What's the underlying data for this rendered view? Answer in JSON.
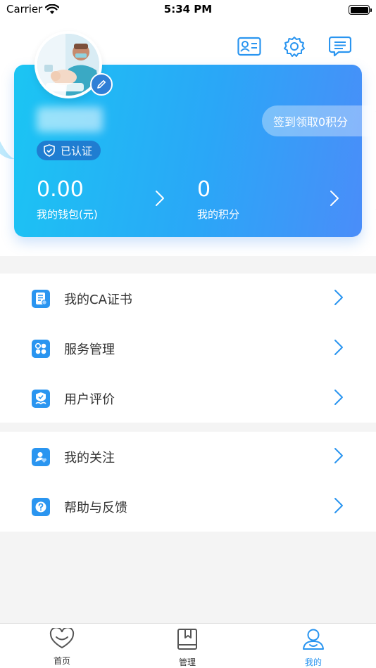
{
  "status_bar": {
    "carrier": "Carrier",
    "time": "5:34 PM"
  },
  "header": {
    "icons": [
      "id-card-icon",
      "gear-icon",
      "message-icon"
    ]
  },
  "profile": {
    "verified_label": "已认证",
    "signin_label": "签到领取0积分",
    "wallet": {
      "value": "0.00",
      "label": "我的钱包(元)"
    },
    "points": {
      "value": "0",
      "label": "我的积分"
    }
  },
  "menu": {
    "section1": [
      {
        "label": "我的CA证书",
        "icon": "certificate-icon"
      },
      {
        "label": "服务管理",
        "icon": "grid-icon"
      },
      {
        "label": "用户评价",
        "icon": "rating-icon"
      }
    ],
    "section2": [
      {
        "label": "我的关注",
        "icon": "follow-icon"
      },
      {
        "label": "帮助与反馈",
        "icon": "help-icon"
      }
    ]
  },
  "tabbar": {
    "tabs": [
      {
        "label": "首页",
        "icon": "heart-icon",
        "active": false
      },
      {
        "label": "管理",
        "icon": "book-icon",
        "active": false
      },
      {
        "label": "我的",
        "icon": "user-icon",
        "active": true
      }
    ]
  },
  "colors": {
    "accent": "#2a95f0",
    "card_start": "#1bc5f3",
    "card_end": "#4a8df9"
  }
}
